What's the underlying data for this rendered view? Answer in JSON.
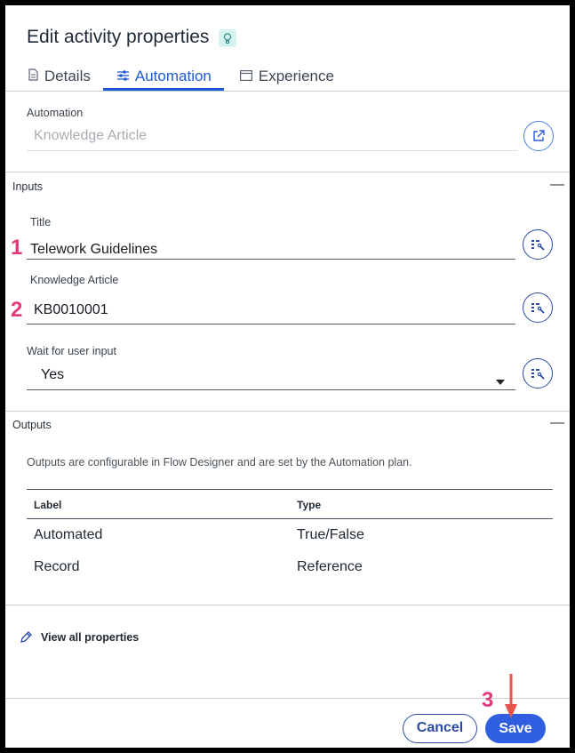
{
  "dialog": {
    "title": "Edit activity properties"
  },
  "tabs": [
    {
      "label": "Details",
      "icon": "document-icon",
      "active": false
    },
    {
      "label": "Automation",
      "icon": "sliders-icon",
      "active": true
    },
    {
      "label": "Experience",
      "icon": "window-icon",
      "active": false
    }
  ],
  "automation": {
    "label": "Automation",
    "value": "Knowledge Article"
  },
  "inputs": {
    "section_title": "Inputs",
    "collapse_symbol": "—",
    "title_field": {
      "label": "Title",
      "value": "Telework Guidelines",
      "step": "1"
    },
    "kb_field": {
      "label": "Knowledge Article",
      "value": "KB0010001",
      "step": "2"
    },
    "wait_field": {
      "label": "Wait for user input",
      "value": "Yes"
    }
  },
  "outputs": {
    "section_title": "Outputs",
    "collapse_symbol": "—",
    "description": "Outputs are configurable in Flow Designer and are set by the Automation plan.",
    "columns": [
      "Label",
      "Type"
    ],
    "rows": [
      {
        "label": "Automated",
        "type": "True/False"
      },
      {
        "label": "Record",
        "type": "Reference"
      }
    ]
  },
  "view_all": {
    "label": "View all properties"
  },
  "footer": {
    "cancel_label": "Cancel",
    "save_label": "Save",
    "step": "3"
  },
  "colors": {
    "accent": "#2f5fe0",
    "annotation": "#e2397a",
    "arrow": "#e8534a"
  }
}
